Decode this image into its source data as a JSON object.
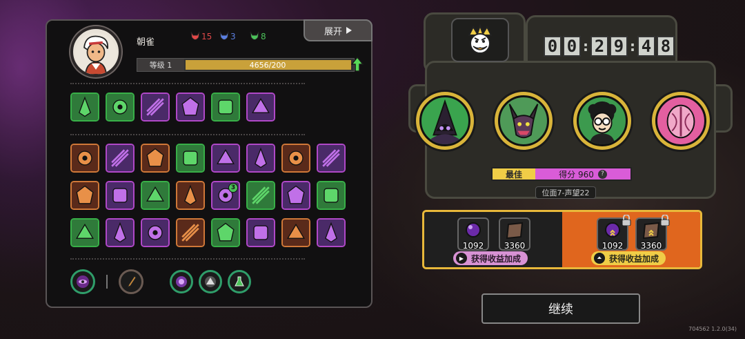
{
  "player": {
    "name": "朝雀",
    "stats": [
      {
        "icon": "red-demon-icon",
        "value": "15",
        "color": "#e04848"
      },
      {
        "icon": "blue-demon-icon",
        "value": "3",
        "color": "#5b7fe0"
      },
      {
        "icon": "green-demon-icon",
        "value": "8",
        "color": "#4cc25a"
      }
    ],
    "level_label": "等级 1",
    "exp_text": "4656/200",
    "exp_fraction": 1.0
  },
  "expand_label": "展开",
  "skills_row1": [
    {
      "icon": "green-leaf-blade-icon",
      "frame": "green"
    },
    {
      "icon": "gold-gem-scroll-icon",
      "frame": "green"
    },
    {
      "icon": "dark-orb-icon",
      "frame": "purple"
    },
    {
      "icon": "twin-claws-icon",
      "frame": "purple"
    },
    {
      "icon": "green-fronds-icon",
      "frame": "green"
    },
    {
      "icon": "stone-tablet-icon",
      "frame": "purple"
    }
  ],
  "skills_grid": [
    {
      "icon": "red-white-slash-icon",
      "frame": "orange"
    },
    {
      "icon": "purple-serpent-icon",
      "frame": "purple"
    },
    {
      "icon": "bronze-compass-icon",
      "frame": "orange"
    },
    {
      "icon": "green-shield-icon",
      "frame": "green"
    },
    {
      "icon": "ghost-spirit-icon",
      "frame": "purple"
    },
    {
      "icon": "x-mark-icon",
      "frame": "purple"
    },
    {
      "icon": "red-guardian-icon",
      "frame": "orange"
    },
    {
      "icon": "dark-statue-icon",
      "frame": "purple"
    },
    {
      "icon": "black-raven-icon",
      "frame": "orange"
    },
    {
      "icon": "gold-arch-icon",
      "frame": "purple"
    },
    {
      "icon": "wooden-wall-icon",
      "frame": "green"
    },
    {
      "icon": "gold-arrows-icon",
      "frame": "orange"
    },
    {
      "icon": "thorny-orb-icon",
      "frame": "purple",
      "badge": "3"
    },
    {
      "icon": "gold-green-chevron-icon",
      "frame": "green"
    },
    {
      "icon": "purple-crow-icon",
      "frame": "purple"
    },
    {
      "icon": "purple-spike-icon",
      "frame": "green"
    },
    {
      "icon": "green-swirl-icon",
      "frame": "green"
    },
    {
      "icon": "pink-star-icon",
      "frame": "purple"
    },
    {
      "icon": "purple-arrows-icon",
      "frame": "purple"
    },
    {
      "icon": "sunrise-icon",
      "frame": "orange"
    },
    {
      "icon": "red-arrow-icon",
      "frame": "green"
    },
    {
      "icon": "pink-eye-icon",
      "frame": "purple"
    },
    {
      "icon": "blue-portal-icon",
      "frame": "orange"
    },
    {
      "icon": "pink-scroll-icon",
      "frame": "purple"
    }
  ],
  "equipment": [
    {
      "icon": "purple-eye-orb-icon"
    },
    {
      "icon": "feather-dagger-icon"
    },
    {
      "icon": "purple-crystal-icon"
    },
    {
      "icon": "silver-triangle-icon"
    },
    {
      "icon": "green-flask-icon"
    }
  ],
  "timer": {
    "h1": "0",
    "h2": "0",
    "m1": "2",
    "m2": "9",
    "s1": "4",
    "s2": "8"
  },
  "bosses": [
    {
      "icon": "dark-hood-boss-icon",
      "bg": "#3aa44e"
    },
    {
      "icon": "horned-demon-boss-icon",
      "bg": "#4f9a58"
    },
    {
      "icon": "glasses-boy-boss-icon",
      "bg": "#3c9a4e"
    },
    {
      "icon": "pink-bulb-boss-icon",
      "bg": "#e35fa0"
    }
  ],
  "best": {
    "label": "最佳",
    "score": "得分 960",
    "help": "?"
  },
  "realm_label": "位面7-声望22",
  "rewards": {
    "left_items": [
      {
        "icon": "purple-orb-item-icon",
        "value": "1092"
      },
      {
        "icon": "brown-book-item-icon",
        "value": "3360"
      }
    ],
    "left_button": "获得收益加成",
    "right_items": [
      {
        "icon": "purple-orb-item-icon",
        "value": "1092"
      },
      {
        "icon": "brown-book-item-icon",
        "value": "3360"
      }
    ],
    "right_button": "获得收益加成"
  },
  "continue_label": "继续",
  "version": "704562 1.2.0(34)",
  "colors": {
    "gold": "#d9b43a",
    "accent_orange": "#e0661e",
    "pink": "#d95cd8"
  }
}
